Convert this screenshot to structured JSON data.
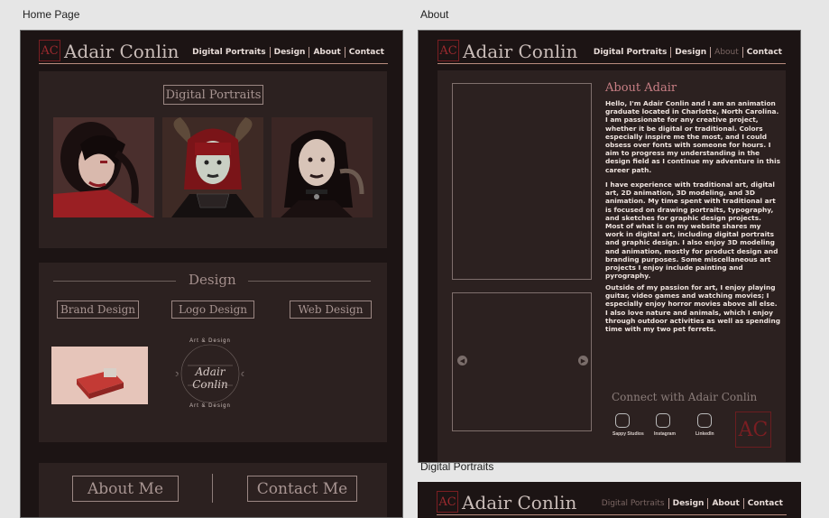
{
  "artboards": {
    "home_label": "Home Page",
    "about_label": "About",
    "portraits_label": "Digital Portraits"
  },
  "header": {
    "brand": "Adair Conlin",
    "logo_mark": "AC",
    "nav": [
      "Digital Portraits",
      "Design",
      "About",
      "Contact"
    ]
  },
  "home": {
    "portraits_title": "Digital Portraits",
    "design_title": "Design",
    "design_buttons": [
      "Brand Design",
      "Logo Design",
      "Web Design"
    ],
    "logo_top": "Art & Design",
    "logo_name_1": "Adair",
    "logo_name_2": "Conlin",
    "logo_bottom": "Art & Design",
    "about_button": "About Me",
    "contact_button": "Contact Me"
  },
  "about": {
    "heading": "About Adair",
    "para1": "Hello, I'm Adair Conlin and I am an animation graduate located in Charlotte, North Carolina. I am passionate for any creative project, whether it be digital or traditional. Colors especially inspire me the most, and I could obsess over fonts with someone for hours. I aim to progress my understanding in the design field as I continue my adventure in this career path.",
    "para2": "I have experience with traditional art, digital art, 2D animation, 3D modeling, and 3D animation. My time spent with traditional art is focused on drawing portraits, typography, and sketches for graphic design projects. Most of what is on my website shares my work in digital art, including digital portraits and graphic design. I also enjoy 3D modeling and animation, mostly for product design and branding purposes. Some miscellaneous art projects I enjoy include painting and pyrography.",
    "para3": "Outside of my passion for art, I enjoy playing guitar, video games and watching movies; I especially enjoy horror movies above all else. I also love nature and animals, which I enjoy through outdoor activities as well as spending time with my two pet ferrets.",
    "connect": "Connect with Adair Conlin",
    "socials": [
      "Sappy Studios",
      "Instagram",
      "LinkedIn"
    ]
  },
  "colors": {
    "accent": "#9b2a2e",
    "background": "#1c1414",
    "panel": "#2c2120"
  }
}
